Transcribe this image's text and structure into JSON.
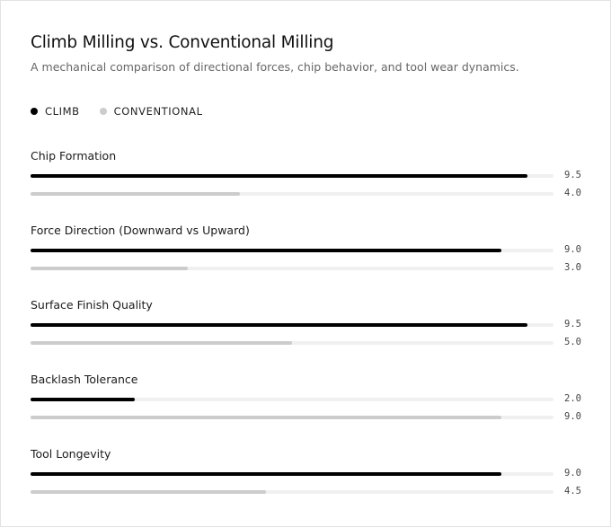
{
  "title": "Climb Milling vs. Conventional Milling",
  "subtitle": "A mechanical comparison of directional forces, chip behavior, and tool wear dynamics.",
  "legend": [
    {
      "label": "CLIMB",
      "color": "#000000"
    },
    {
      "label": "CONVENTIONAL",
      "color": "#cccccc"
    }
  ],
  "chart_data": {
    "type": "bar",
    "orientation": "horizontal",
    "title": "Climb Milling vs. Conventional Milling",
    "subtitle": "A mechanical comparison of directional forces, chip behavior, and tool wear dynamics.",
    "categories": [
      "Chip Formation",
      "Force Direction (Downward vs Upward)",
      "Surface Finish Quality",
      "Backlash Tolerance",
      "Tool Longevity"
    ],
    "series": [
      {
        "name": "CLIMB",
        "color": "#000000",
        "values": [
          9.5,
          9.0,
          9.5,
          2.0,
          9.0
        ],
        "labels": [
          "9.5",
          "9.0",
          "9.5",
          "2.0",
          "9.0"
        ]
      },
      {
        "name": "CONVENTIONAL",
        "color": "#cccccc",
        "values": [
          4.0,
          3.0,
          5.0,
          9.0,
          4.5
        ],
        "labels": [
          "4.0",
          "3.0",
          "5.0",
          "9.0",
          "4.5"
        ]
      }
    ],
    "xlim": [
      0,
      10
    ],
    "legend_position": "top-left",
    "grid": false
  }
}
